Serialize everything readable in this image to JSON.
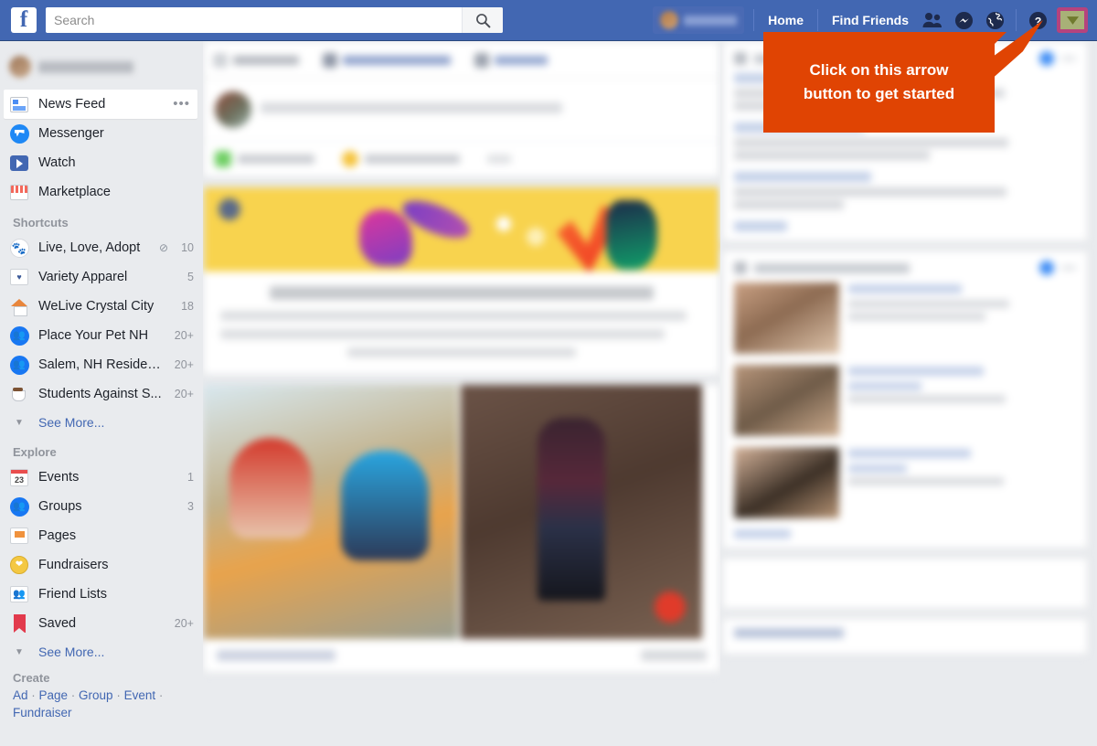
{
  "topbar": {
    "logo": "f",
    "search": {
      "value": "",
      "placeholder": "Search",
      "icon": "search-icon"
    },
    "home_label": "Home",
    "find_friends_label": "Find Friends",
    "icons": [
      "friend-requests-icon",
      "messenger-icon",
      "notifications-globe-icon",
      "help-icon",
      "account-arrow-icon"
    ]
  },
  "sidebar": {
    "main_items": [
      {
        "label": "News Feed",
        "icon": "news-feed-icon",
        "count": "",
        "active": true,
        "more": "•••"
      },
      {
        "label": "Messenger",
        "icon": "messenger-icon",
        "count": "",
        "active": false
      },
      {
        "label": "Watch",
        "icon": "watch-icon",
        "count": "",
        "active": false
      },
      {
        "label": "Marketplace",
        "icon": "marketplace-icon",
        "count": "",
        "active": false
      }
    ],
    "shortcuts_header": "Shortcuts",
    "shortcuts": [
      {
        "label": "Live, Love, Adopt",
        "icon": "paw-icon",
        "count": "10",
        "muted": true
      },
      {
        "label": "Variety Apparel",
        "icon": "shirt-icon",
        "count": "5",
        "muted": false
      },
      {
        "label": "WeLive Crystal City",
        "icon": "house-icon",
        "count": "18",
        "muted": false
      },
      {
        "label": "Place Your Pet NH",
        "icon": "group-icon",
        "count": "20+",
        "muted": false
      },
      {
        "label": "Salem, NH Residen...",
        "icon": "group-icon",
        "count": "20+",
        "muted": false
      },
      {
        "label": "Students Against S...",
        "icon": "coffee-cup-icon",
        "count": "20+",
        "muted": false
      }
    ],
    "shortcuts_see_more": "See More...",
    "explore_header": "Explore",
    "explore": [
      {
        "label": "Events",
        "icon": "calendar-icon",
        "count": "1",
        "badge": "23"
      },
      {
        "label": "Groups",
        "icon": "groups-icon",
        "count": "3"
      },
      {
        "label": "Pages",
        "icon": "pages-flag-icon",
        "count": ""
      },
      {
        "label": "Fundraisers",
        "icon": "fundraiser-coin-icon",
        "count": ""
      },
      {
        "label": "Friend Lists",
        "icon": "friend-lists-icon",
        "count": ""
      },
      {
        "label": "Saved",
        "icon": "saved-bookmark-icon",
        "count": "20+"
      }
    ],
    "explore_see_more": "See More...",
    "create_header": "Create",
    "create_links": [
      "Ad",
      "Page",
      "Group",
      "Event",
      "Fundraiser"
    ]
  },
  "callout": {
    "line1": "Click on this arrow",
    "line2": "button to get started",
    "bg_color": "#e04403",
    "text_color": "#ffffff"
  },
  "highlight": {
    "border_color": "#b5437d",
    "fill_color": "#a8b177"
  },
  "colors": {
    "chrome_blue": "#4267b2",
    "page_bg": "#e9ebee",
    "card_bg": "#ffffff",
    "link_blue": "#4267b2",
    "banner_yellow": "#f8d34e"
  }
}
